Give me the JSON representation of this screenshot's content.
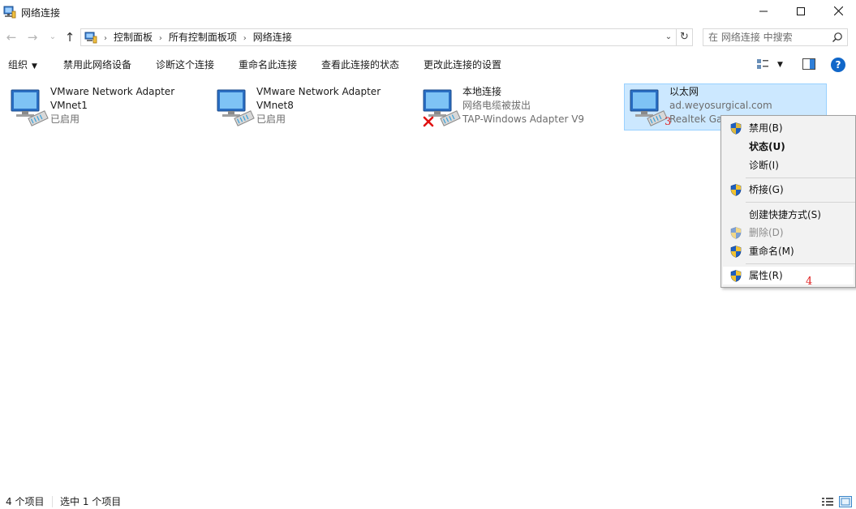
{
  "window": {
    "title": "网络连接",
    "minimize_icon": "minimize-icon",
    "maximize_icon": "maximize-icon",
    "close_icon": "close-icon"
  },
  "address": {
    "crumbs": [
      "控制面板",
      "所有控制面板项",
      "网络连接"
    ],
    "search_placeholder": "在 网络连接 中搜索"
  },
  "commands": {
    "organize": "组织",
    "disable": "禁用此网络设备",
    "diagnose": "诊断这个连接",
    "rename": "重命名此连接",
    "view_status": "查看此连接的状态",
    "change_settings": "更改此连接的设置",
    "help": "?"
  },
  "connections": [
    {
      "name": "VMware Network Adapter",
      "sub": "VMnet1",
      "sub2": "已启用",
      "selected": false,
      "disconnected": false
    },
    {
      "name": "VMware Network Adapter",
      "sub": "VMnet8",
      "sub2": "已启用",
      "selected": false,
      "disconnected": false
    },
    {
      "name": "本地连接",
      "sub": "网络电缆被拔出",
      "sub2": "TAP-Windows Adapter V9",
      "selected": false,
      "disconnected": true
    },
    {
      "name": "以太网",
      "sub": "ad.weyosurgical.com",
      "sub2": "Realtek Ga",
      "selected": true,
      "disconnected": false
    }
  ],
  "context_menu": [
    {
      "label": "禁用(B)",
      "shield": true,
      "bold": false,
      "disabled": false
    },
    {
      "label": "状态(U)",
      "shield": false,
      "bold": true,
      "disabled": false
    },
    {
      "label": "诊断(I)",
      "shield": false,
      "bold": false,
      "disabled": false
    },
    {
      "label": "桥接(G)",
      "shield": true,
      "bold": false,
      "disabled": false
    },
    {
      "label": "创建快捷方式(S)",
      "shield": false,
      "bold": false,
      "disabled": false
    },
    {
      "label": "删除(D)",
      "shield": true,
      "bold": false,
      "disabled": true
    },
    {
      "label": "重命名(M)",
      "shield": true,
      "bold": false,
      "disabled": false
    },
    {
      "label": "属性(R)",
      "shield": true,
      "bold": false,
      "disabled": false
    }
  ],
  "annotations": {
    "a3": "3",
    "a4": "4"
  },
  "status": {
    "count": "4 个项目",
    "selected": "选中 1 个项目"
  },
  "colors": {
    "selection": "#cce8ff",
    "selection_border": "#99d1ff",
    "annotation": "#e02020",
    "help": "#1167c9"
  }
}
